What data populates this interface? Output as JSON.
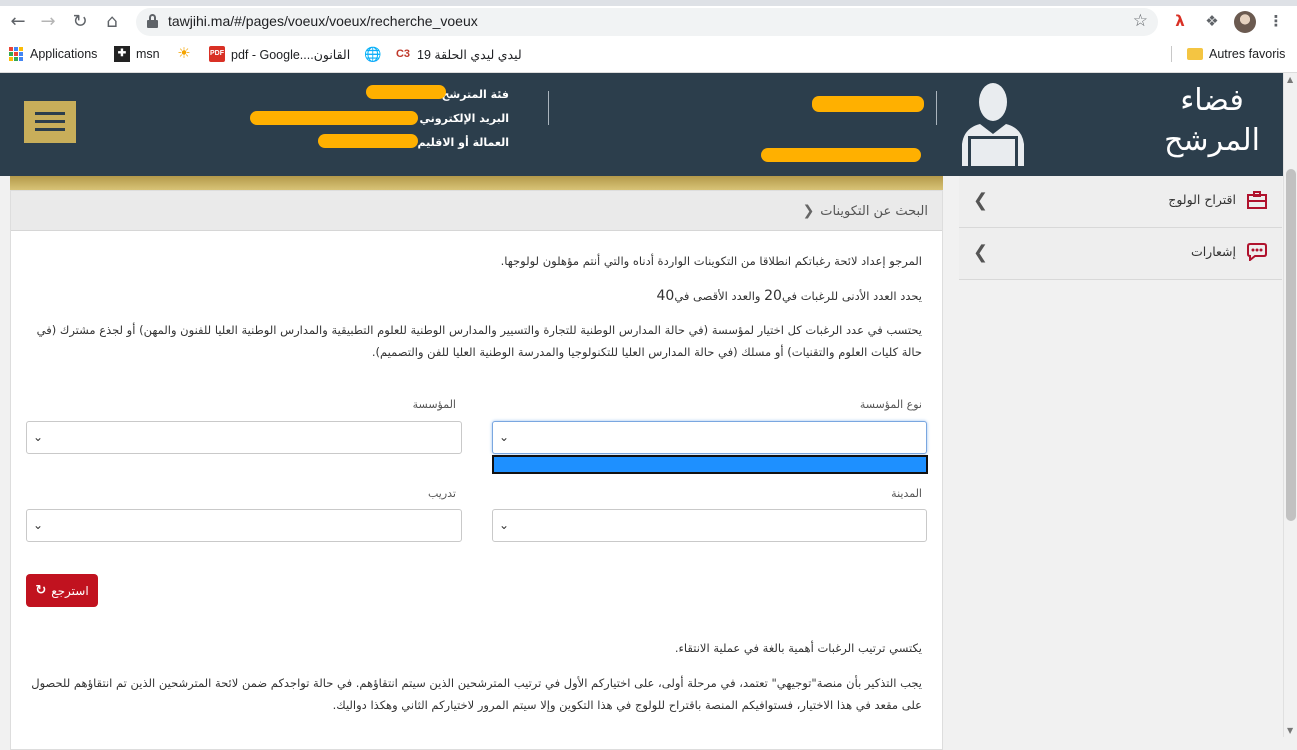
{
  "browser": {
    "url": "tawjihi.ma/#/pages/voeux/voeux/recherche_voeux",
    "bookmarks": [
      {
        "label": "Applications",
        "icon": "apps-grid-icon"
      },
      {
        "label": "msn",
        "icon": "msn-icon"
      },
      {
        "label": "",
        "icon": "sun-icon"
      },
      {
        "label": "pdf - Google....القانون",
        "icon": "pdf-icon"
      },
      {
        "label": "",
        "icon": "globe-icon"
      },
      {
        "label": "ليدي ليدي الحلقة 19",
        "icon": "c3-icon"
      }
    ],
    "other_bookmarks": "Autres favoris"
  },
  "header": {
    "logo_title": "فضاء المرشح",
    "candidate_category_label": "فئة المترشح :",
    "email_label": "البريد الإلكتروني :",
    "prefecture_label": "العمالة أو الاقليم :"
  },
  "side_menu": {
    "items": [
      {
        "label": "اقتراح الولوج",
        "icon": "briefcase-icon"
      },
      {
        "label": "إشعارات",
        "icon": "chat-bubble-icon"
      }
    ]
  },
  "main": {
    "title": "البحث عن التكوينات",
    "intro": "المرجو إعداد لائحة رغباتكم انطلاقا من التكوينات الواردة أدناه والتي أنتم مؤهلون لولوجها.",
    "limits": {
      "prefix": "يحدد العدد الأدنى للرغبات في",
      "min": "20",
      "middle": "والعدد الأقصى في",
      "max": "40"
    },
    "counting_rule": "يحتسب في عدد الرغبات كل اختيار لمؤسسة (في حالة المدارس الوطنية للتجارة والتسيير والمدارس الوطنية للعلوم التطبيقية والمدارس الوطنية العليا للفنون والمهن) أو لجذع مشترك (في حالة كليات العلوم والتقنيات) أو مسلك (في حالة المدارس العليا للتكنولوجيا والمدرسة الوطنية العليا للفن والتصميم).",
    "filters": {
      "institution_type_label": "نوع المؤسسة",
      "institution_label": "المؤسسة",
      "city_label": "المدينة",
      "training_label": "تدريب"
    },
    "refresh_label": "استرجع",
    "importance_note": "يكتسي ترتيب الرغبات أهمية بالغة في عملية الانتقاء.",
    "reminder": "يجب التذكير بأن منصة\"توجيهي\" تعتمد، في مرحلة أولى، على اختياركم الأول في ترتيب المترشحين الذين سيتم انتقاؤهم. في حالة تواجدكم ضمن لائحة المترشحين الذين تم انتقاؤهم للحصول على مقعد في هذا الاختيار، فستوافيكم المنصة باقتراح للولوج في هذا التكوين وإلا سيتم المرور لاختياركم الثاني وهكذا دواليك."
  }
}
